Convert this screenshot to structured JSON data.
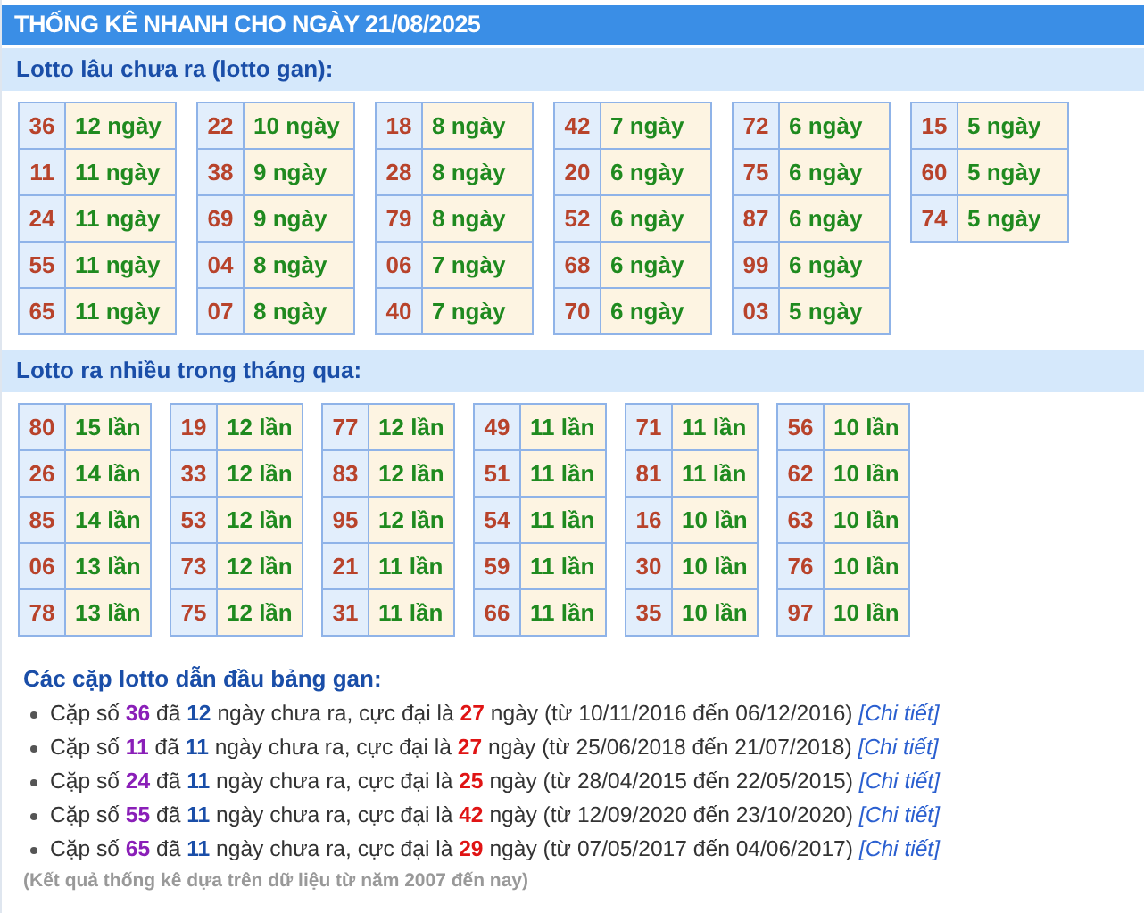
{
  "title": "THỐNG KÊ NHANH CHO NGÀY 21/08/2025",
  "gan_section": {
    "heading": "Lotto lâu chưa ra (lotto gan):",
    "columns": [
      [
        [
          "36",
          "12 ngày"
        ],
        [
          "11",
          "11 ngày"
        ],
        [
          "24",
          "11 ngày"
        ],
        [
          "55",
          "11 ngày"
        ],
        [
          "65",
          "11 ngày"
        ]
      ],
      [
        [
          "22",
          "10 ngày"
        ],
        [
          "38",
          "9 ngày"
        ],
        [
          "69",
          "9 ngày"
        ],
        [
          "04",
          "8 ngày"
        ],
        [
          "07",
          "8 ngày"
        ]
      ],
      [
        [
          "18",
          "8 ngày"
        ],
        [
          "28",
          "8 ngày"
        ],
        [
          "79",
          "8 ngày"
        ],
        [
          "06",
          "7 ngày"
        ],
        [
          "40",
          "7 ngày"
        ]
      ],
      [
        [
          "42",
          "7 ngày"
        ],
        [
          "20",
          "6 ngày"
        ],
        [
          "52",
          "6 ngày"
        ],
        [
          "68",
          "6 ngày"
        ],
        [
          "70",
          "6 ngày"
        ]
      ],
      [
        [
          "72",
          "6 ngày"
        ],
        [
          "75",
          "6 ngày"
        ],
        [
          "87",
          "6 ngày"
        ],
        [
          "99",
          "6 ngày"
        ],
        [
          "03",
          "5 ngày"
        ]
      ],
      [
        [
          "15",
          "5 ngày"
        ],
        [
          "60",
          "5 ngày"
        ],
        [
          "74",
          "5 ngày"
        ]
      ]
    ]
  },
  "frequent_section": {
    "heading": "Lotto ra nhiều trong tháng qua:",
    "columns": [
      [
        [
          "80",
          "15 lần"
        ],
        [
          "26",
          "14 lần"
        ],
        [
          "85",
          "14 lần"
        ],
        [
          "06",
          "13 lần"
        ],
        [
          "78",
          "13 lần"
        ]
      ],
      [
        [
          "19",
          "12 lần"
        ],
        [
          "33",
          "12 lần"
        ],
        [
          "53",
          "12 lần"
        ],
        [
          "73",
          "12 lần"
        ],
        [
          "75",
          "12 lần"
        ]
      ],
      [
        [
          "77",
          "12 lần"
        ],
        [
          "83",
          "12 lần"
        ],
        [
          "95",
          "12 lần"
        ],
        [
          "21",
          "11 lần"
        ],
        [
          "31",
          "11 lần"
        ]
      ],
      [
        [
          "49",
          "11 lần"
        ],
        [
          "51",
          "11 lần"
        ],
        [
          "54",
          "11 lần"
        ],
        [
          "59",
          "11 lần"
        ],
        [
          "66",
          "11 lần"
        ]
      ],
      [
        [
          "71",
          "11 lần"
        ],
        [
          "81",
          "11 lần"
        ],
        [
          "16",
          "10 lần"
        ],
        [
          "30",
          "10 lần"
        ],
        [
          "35",
          "10 lần"
        ]
      ],
      [
        [
          "56",
          "10 lần"
        ],
        [
          "62",
          "10 lần"
        ],
        [
          "63",
          "10 lần"
        ],
        [
          "76",
          "10 lần"
        ],
        [
          "97",
          "10 lần"
        ]
      ]
    ]
  },
  "pairs_section": {
    "heading": "Các cặp lotto dẫn đầu bảng gan:",
    "items": [
      {
        "segments": [
          {
            "kind": "text",
            "text": "Cặp số "
          },
          {
            "kind": "pair",
            "text": "36"
          },
          {
            "kind": "text",
            "text": " đã "
          },
          {
            "kind": "days",
            "text": "12"
          },
          {
            "kind": "text",
            "text": " ngày chưa ra, cực đại là "
          },
          {
            "kind": "max",
            "text": "27"
          },
          {
            "kind": "text",
            "text": " ngày (từ 10/11/2016 đến 06/12/2016)"
          }
        ],
        "link": "[Chi tiết]"
      },
      {
        "segments": [
          {
            "kind": "text",
            "text": "Cặp số "
          },
          {
            "kind": "pair",
            "text": "11"
          },
          {
            "kind": "text",
            "text": " đã "
          },
          {
            "kind": "days",
            "text": "11"
          },
          {
            "kind": "text",
            "text": " ngày chưa ra, cực đại là "
          },
          {
            "kind": "max",
            "text": "27"
          },
          {
            "kind": "text",
            "text": " ngày (từ 25/06/2018 đến 21/07/2018)"
          }
        ],
        "link": "[Chi tiết]"
      },
      {
        "segments": [
          {
            "kind": "text",
            "text": "Cặp số "
          },
          {
            "kind": "pair",
            "text": "24"
          },
          {
            "kind": "text",
            "text": " đã "
          },
          {
            "kind": "days",
            "text": "11"
          },
          {
            "kind": "text",
            "text": " ngày chưa ra, cực đại là "
          },
          {
            "kind": "max",
            "text": "25"
          },
          {
            "kind": "text",
            "text": " ngày (từ 28/04/2015 đến 22/05/2015)"
          }
        ],
        "link": "[Chi tiết]"
      },
      {
        "segments": [
          {
            "kind": "text",
            "text": "Cặp số "
          },
          {
            "kind": "pair",
            "text": "55"
          },
          {
            "kind": "text",
            "text": " đã "
          },
          {
            "kind": "days",
            "text": "11"
          },
          {
            "kind": "text",
            "text": " ngày chưa ra, cực đại là "
          },
          {
            "kind": "max",
            "text": "42"
          },
          {
            "kind": "text",
            "text": " ngày (từ 12/09/2020 đến 23/10/2020)"
          }
        ],
        "link": "[Chi tiết]"
      },
      {
        "segments": [
          {
            "kind": "text",
            "text": "Cặp số "
          },
          {
            "kind": "pair",
            "text": "65"
          },
          {
            "kind": "text",
            "text": " đã "
          },
          {
            "kind": "days",
            "text": "11"
          },
          {
            "kind": "text",
            "text": " ngày chưa ra, cực đại là "
          },
          {
            "kind": "max",
            "text": "29"
          },
          {
            "kind": "text",
            "text": " ngày (từ 07/05/2017 đến 04/06/2017)"
          }
        ],
        "link": "[Chi tiết]"
      }
    ],
    "note": "(Kết quả thống kê dựa trên dữ liệu từ năm 2007 đến nay)"
  }
}
